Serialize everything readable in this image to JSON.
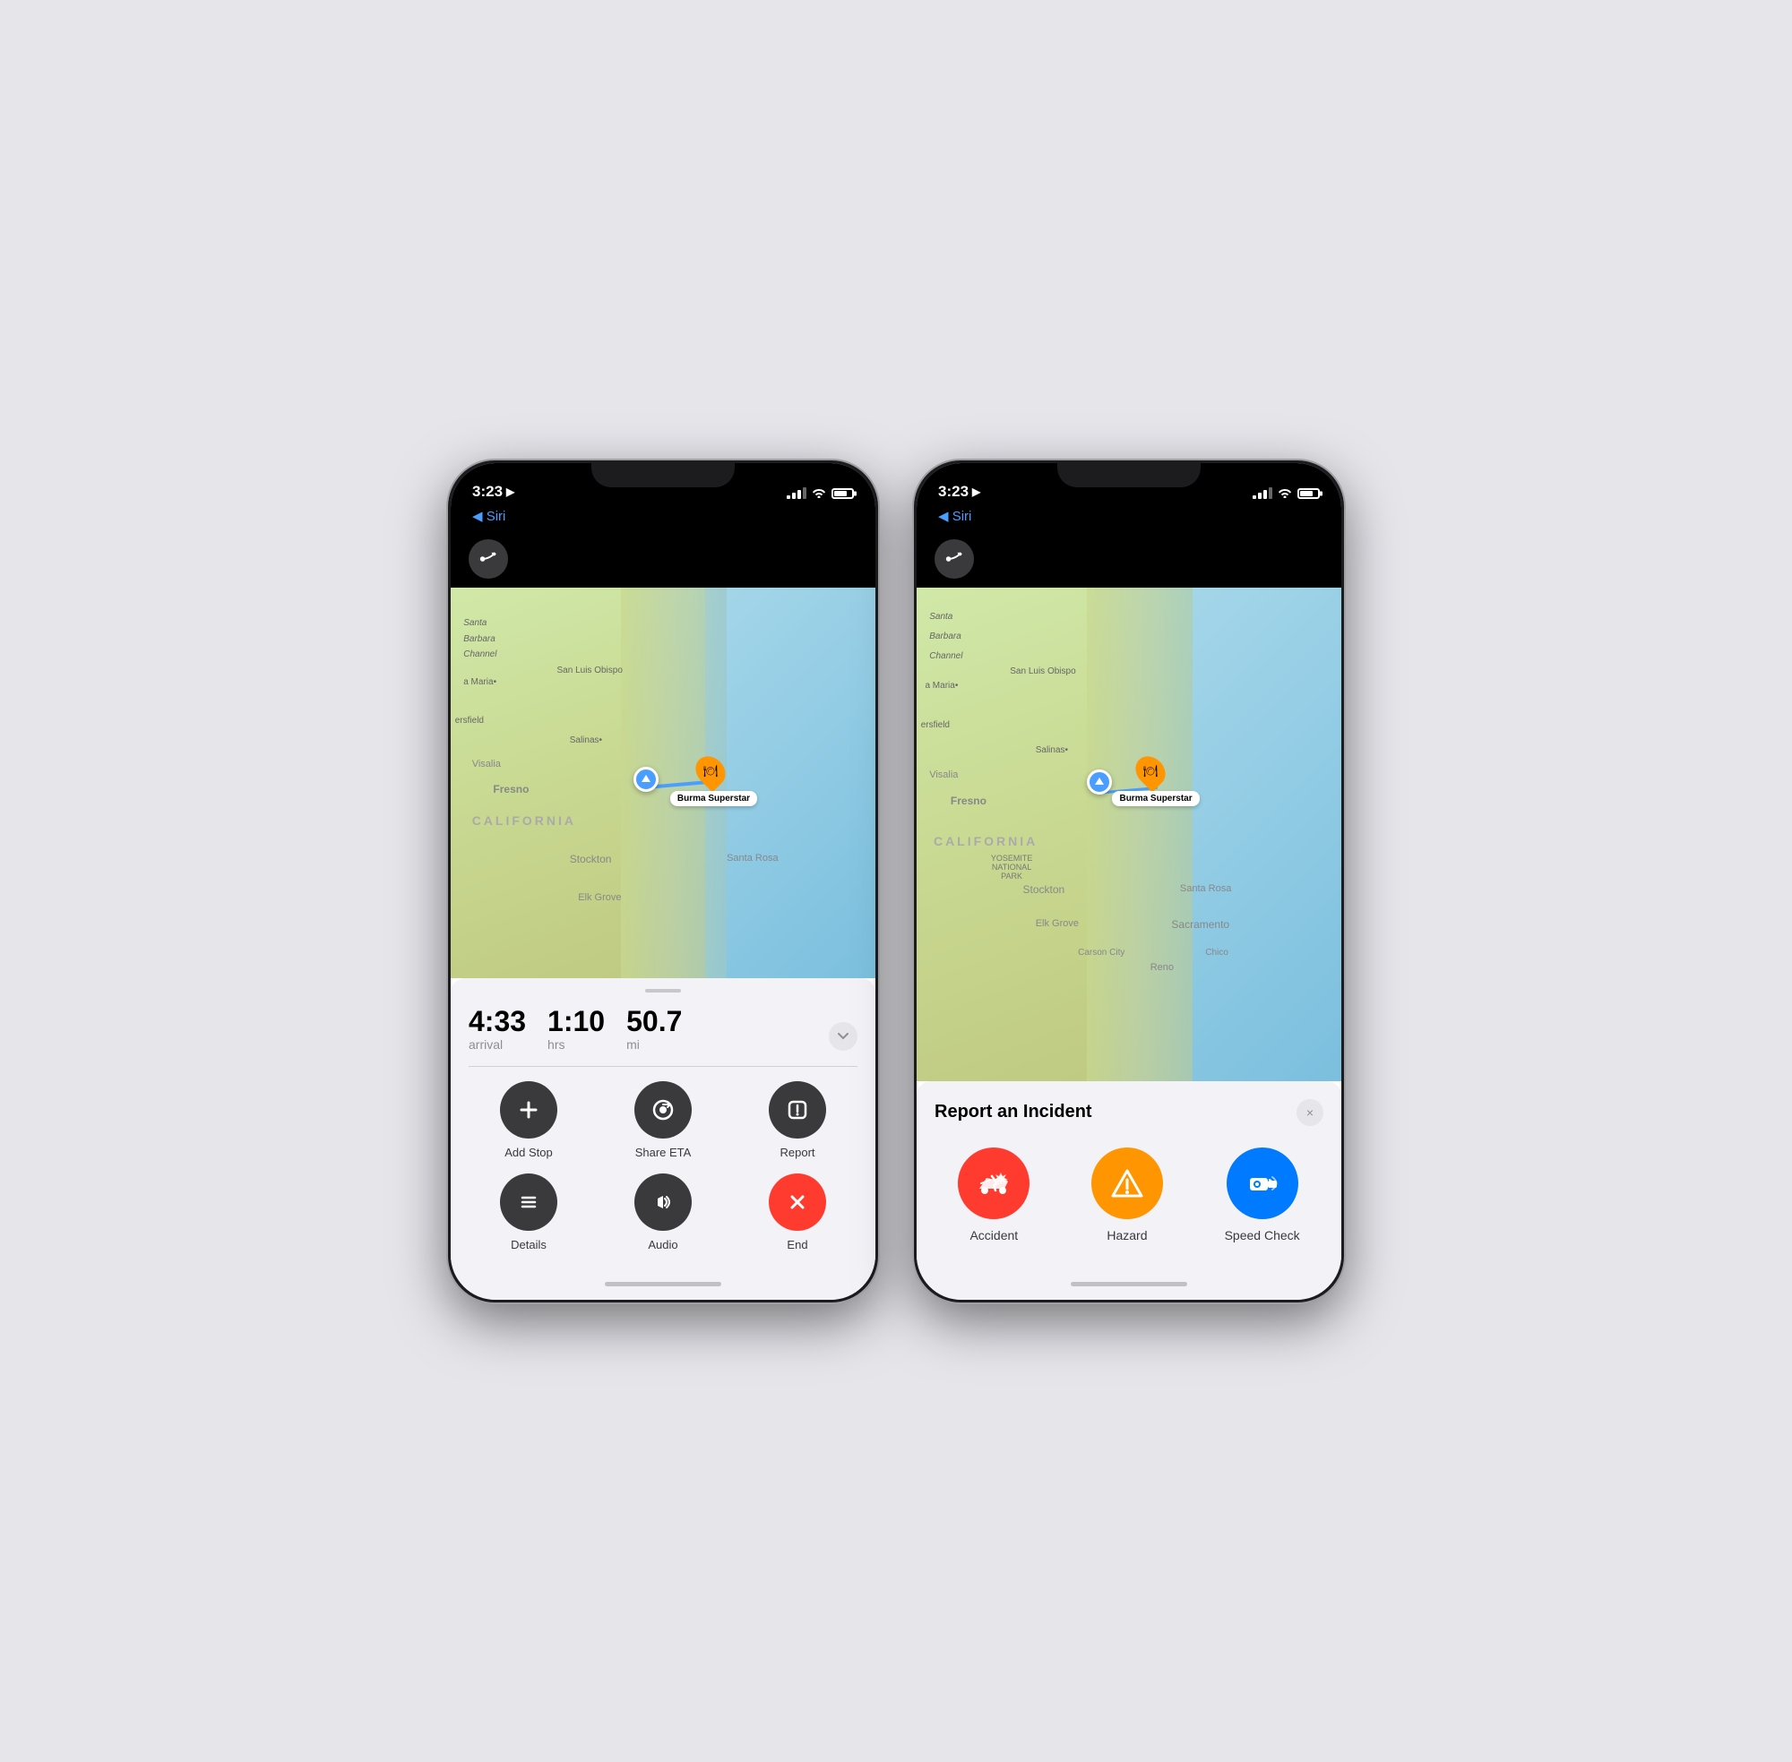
{
  "phones": [
    {
      "id": "phone-navigation",
      "status_bar": {
        "time": "3:23",
        "location_icon": "▶",
        "back_label": "◀ Siri"
      },
      "nav": {
        "icon": "route"
      },
      "map": {
        "destination": "Burma Superstar",
        "city_labels": [
          "Santa Barbara Channel",
          "a Maria",
          "San Luis Obispo",
          "ersfield",
          "Salinas",
          "Visalia",
          "Fresno",
          "CALIFORNIA",
          "Stockton",
          "Santa Rosa",
          "Elk Grove"
        ]
      },
      "trip_info": {
        "arrival_value": "4:33",
        "arrival_label": "arrival",
        "duration_value": "1:10",
        "duration_label": "hrs",
        "distance_value": "50.7",
        "distance_label": "mi"
      },
      "actions": [
        {
          "id": "add-stop",
          "label": "Add Stop",
          "icon": "plus",
          "color": "dark"
        },
        {
          "id": "share-eta",
          "label": "Share ETA",
          "icon": "share-eta",
          "color": "dark"
        },
        {
          "id": "report",
          "label": "Report",
          "icon": "report",
          "color": "dark"
        },
        {
          "id": "details",
          "label": "Details",
          "icon": "list",
          "color": "dark"
        },
        {
          "id": "audio",
          "label": "Audio",
          "icon": "speaker",
          "color": "dark"
        },
        {
          "id": "end",
          "label": "End",
          "icon": "x",
          "color": "red"
        }
      ]
    },
    {
      "id": "phone-incident",
      "status_bar": {
        "time": "3:23",
        "location_icon": "▶",
        "back_label": "◀ Siri"
      },
      "nav": {
        "icon": "route"
      },
      "map": {
        "destination": "Burma Superstar",
        "city_labels": [
          "Santa Barbara Channel",
          "a Maria",
          "San Luis Obispo",
          "ersfield",
          "Salinas",
          "Visalia",
          "Fresno",
          "CALIFORNIA",
          "Stockton",
          "Santa Rosa",
          "Elk Grove",
          "Sacramento",
          "Reno",
          "Carson City",
          "Chico",
          "YOSEMITE NATIONAL PARK"
        ]
      },
      "report_panel": {
        "title": "Report an Incident",
        "close_label": "×",
        "incidents": [
          {
            "id": "accident",
            "label": "Accident",
            "color": "red"
          },
          {
            "id": "hazard",
            "label": "Hazard",
            "color": "orange"
          },
          {
            "id": "speed-check",
            "label": "Speed Check",
            "color": "blue"
          }
        ]
      }
    }
  ]
}
